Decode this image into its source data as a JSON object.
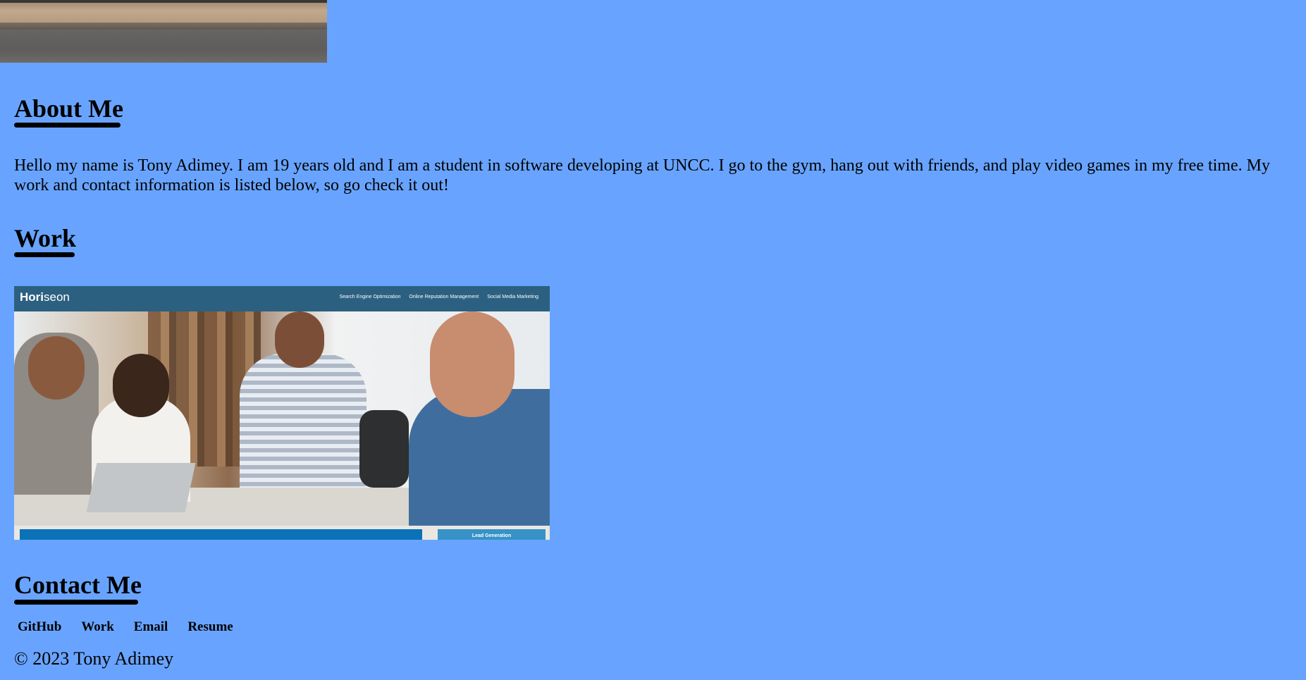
{
  "background_color": "#68a4ff",
  "about": {
    "title": "About Me",
    "text": "Hello my name is Tony Adimey. I am 19 years old and I am a student in software developing at UNCC. I go to the gym, hang out with friends, and play video games in my free time. My work and contact information is listed below, so go check it out!"
  },
  "work": {
    "title": "Work",
    "screenshot": {
      "logo_bold": "Hori",
      "logo_light": "seon",
      "nav_links": [
        "Search Engine Optimization",
        "Online Reputation Management",
        "Social Media Marketing"
      ],
      "side_label": "Lead Generation"
    }
  },
  "contact": {
    "title": "Contact Me",
    "links": [
      "GitHub",
      "Work",
      "Email",
      "Resume"
    ]
  },
  "footer": {
    "text": "© 2023 Tony Adimey"
  }
}
